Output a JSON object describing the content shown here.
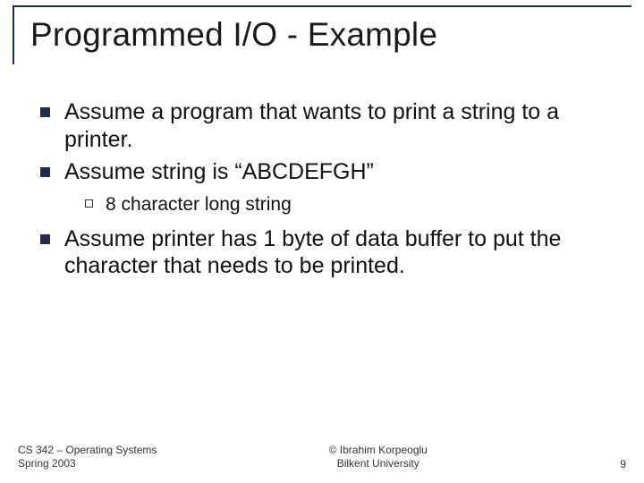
{
  "title": "Programmed I/O - Example",
  "bullets": {
    "b1": "Assume a program that wants to print a string to a printer.",
    "b2": "Assume string is “ABCDEFGH”",
    "b2_sub1": "8 character long string",
    "b3": "Assume printer has 1 byte of data buffer to put the character that needs to be printed."
  },
  "footer": {
    "course_line1": "CS 342 – Operating Systems",
    "course_line2": "Spring 2003",
    "copyright_line1": "© Ibrahim Korpeoglu",
    "copyright_line2": "Bilkent University",
    "page_number": "9"
  }
}
